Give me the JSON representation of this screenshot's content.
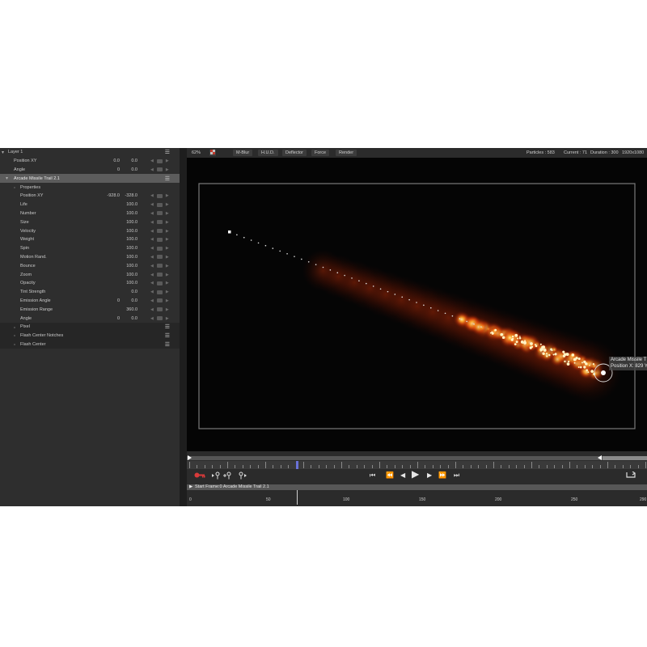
{
  "layers": [
    {
      "label": "Layer 1",
      "indent": 0,
      "caret": true,
      "menu": true
    },
    {
      "label": "Position XY",
      "indent": 1,
      "v1": "0.0",
      "v2": "0.0",
      "controls": true
    },
    {
      "label": "Angle",
      "indent": 1,
      "v1": "0",
      "v2": "0.0",
      "controls": true
    },
    {
      "label": "Arcade Missile Trail 2.1",
      "indent": 0,
      "caret": true,
      "menu": true,
      "selected": true
    },
    {
      "label": "Properties",
      "indent": 2,
      "dot": true
    },
    {
      "label": "Position XY",
      "indent": 2,
      "v1": "-928.0",
      "v2": "-328.0",
      "controls": true
    },
    {
      "label": "Life",
      "indent": 2,
      "v2": "100.0",
      "controls": true
    },
    {
      "label": "Number",
      "indent": 2,
      "v2": "100.0",
      "controls": true
    },
    {
      "label": "Size",
      "indent": 2,
      "v2": "100.0",
      "controls": true
    },
    {
      "label": "Velocity",
      "indent": 2,
      "v2": "100.0",
      "controls": true
    },
    {
      "label": "Weight",
      "indent": 2,
      "v2": "100.0",
      "controls": true
    },
    {
      "label": "Spin",
      "indent": 2,
      "v2": "100.0",
      "controls": true
    },
    {
      "label": "Motion Rand.",
      "indent": 2,
      "v2": "100.0",
      "controls": true
    },
    {
      "label": "Bounce",
      "indent": 2,
      "v2": "100.0",
      "controls": true
    },
    {
      "label": "Zoom",
      "indent": 2,
      "v2": "100.0",
      "controls": true
    },
    {
      "label": "Opacity",
      "indent": 2,
      "v2": "100.0",
      "controls": true
    },
    {
      "label": "Tint Strength",
      "indent": 2,
      "v2": "0.0",
      "controls": true
    },
    {
      "label": "Emission Angle",
      "indent": 2,
      "v1": "0",
      "v2": "0.0",
      "controls": true
    },
    {
      "label": "Emission Range",
      "indent": 2,
      "v2": "360.0",
      "controls": true
    },
    {
      "label": "Angle",
      "indent": 2,
      "v1": "0",
      "v2": "0.0",
      "controls": true
    },
    {
      "label": "Pixel",
      "indent": 2,
      "dot": true,
      "menu": true,
      "dark": true
    },
    {
      "label": "Flash Center Notches",
      "indent": 2,
      "dot": true,
      "menu": true,
      "dark": true
    },
    {
      "label": "Flash Center",
      "indent": 2,
      "dot": true,
      "menu": true,
      "dark": true
    }
  ],
  "toolbar": {
    "zoom": "62%",
    "mblur": "M-Blur",
    "hud": "H.U.D.",
    "deflector": "Deflector",
    "force": "Force",
    "render": "Render"
  },
  "status": {
    "particles": "Particles : 583",
    "current": "Current : 71",
    "duration": "Duration : 300",
    "resolution": "1920x1080"
  },
  "hud": {
    "line1": "Arcade Missile T",
    "line2": "Position X: 829 Y"
  },
  "track": {
    "title": "Start Frame:0 Arcade Missile Trail 2.1"
  },
  "frames": [
    "0",
    "50",
    "100",
    "150",
    "200",
    "250",
    "290"
  ],
  "playhead_frame": 71,
  "colors": {
    "accent_red": "#d83a3a",
    "panel": "#2e2e2e",
    "selected": "#5c5c5c"
  }
}
